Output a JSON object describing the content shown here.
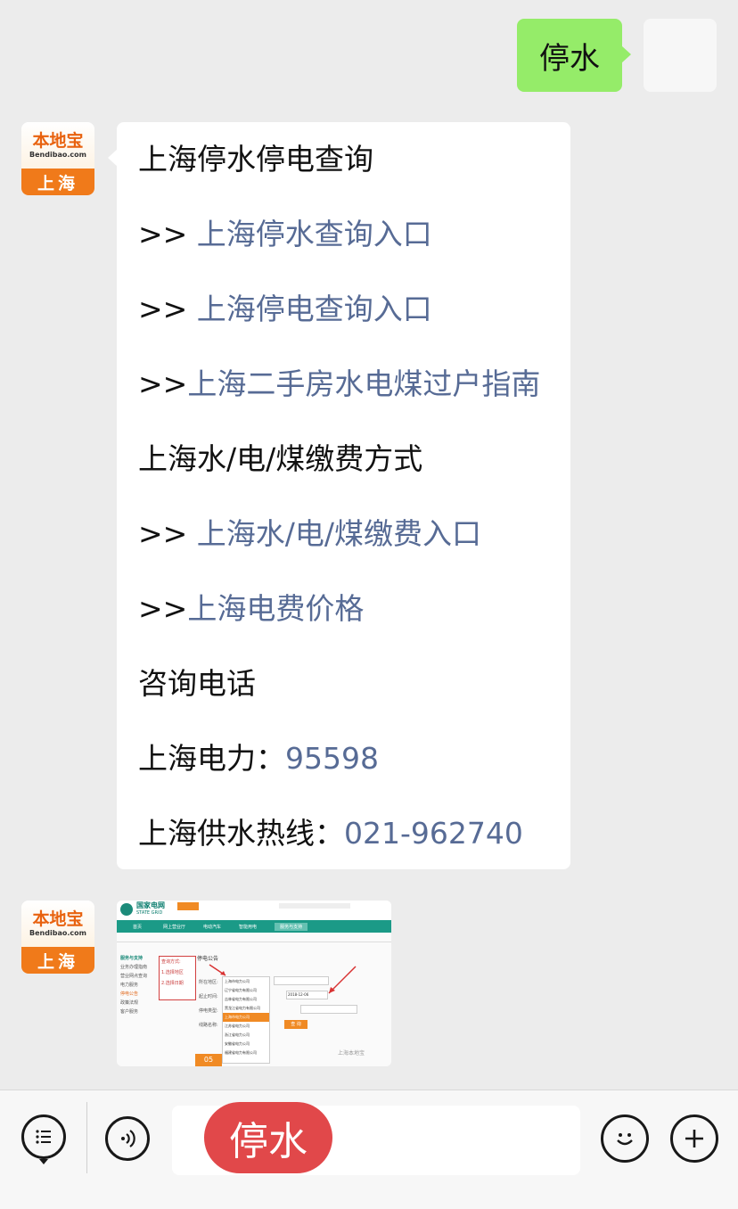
{
  "user_message": {
    "text": "停水"
  },
  "bot": {
    "avatar": {
      "brand": "本地宝",
      "domain": "Bendibao.com",
      "city": "上海"
    }
  },
  "reply": {
    "lines": [
      {
        "text": "上海停水停电查询"
      },
      {
        "prefix": ">> ",
        "text": "上海停水查询入口"
      },
      {
        "prefix": ">> ",
        "text": "上海停电查询入口"
      },
      {
        "prefix": ">>",
        "text": "上海二手房水电煤过户指南"
      },
      {
        "text": "上海水/电/煤缴费方式"
      },
      {
        "prefix": ">> ",
        "text": "上海水/电/煤缴费入口"
      },
      {
        "prefix": ">>",
        "text": "上海电费价格"
      },
      {
        "text": "咨询电话"
      },
      {
        "label": "上海电力：",
        "value": "95598"
      },
      {
        "label": "上海供水热线：",
        "value": "021-962740"
      }
    ]
  },
  "image_message": {
    "site_logo": "国家电网",
    "site_logo_en": "STATE GRID",
    "nav": [
      "首页",
      "网上营业厅",
      "电动汽车",
      "智能用电",
      "服务与支持"
    ],
    "sidebar_title": "服务与支持",
    "sidebar_items": [
      "业务办理指南",
      "营业网点查询",
      "电力服务",
      "停电公告",
      "政策法规",
      "客户服务"
    ],
    "page_title": "停电公告",
    "annotation": {
      "title": "查询方式:",
      "step1": "1.选择地区",
      "step2": "2.选择日期"
    },
    "form_labels": [
      "所在地区:",
      "起止时间:",
      "停电类型:",
      "线路名称:"
    ],
    "region_value": "上海市电力公司",
    "date_value": "2018-12-06",
    "dropdown_options": [
      "辽宁省电力有限公司",
      "吉林省电力有限公司",
      "黑龙江省电力有限公司",
      "上海市电力公司",
      "江苏省电力公司",
      "浙江省电力公司",
      "安徽省电力公司",
      "福建省电力有限公司"
    ],
    "query_button": "查 询",
    "page_badge": "05",
    "watermark": "上海本地宝"
  },
  "bottom_bar": {
    "icons": [
      "menu-icon",
      "voice-icon",
      "emoji-icon",
      "plus-icon"
    ],
    "sticker_text": "停水"
  }
}
